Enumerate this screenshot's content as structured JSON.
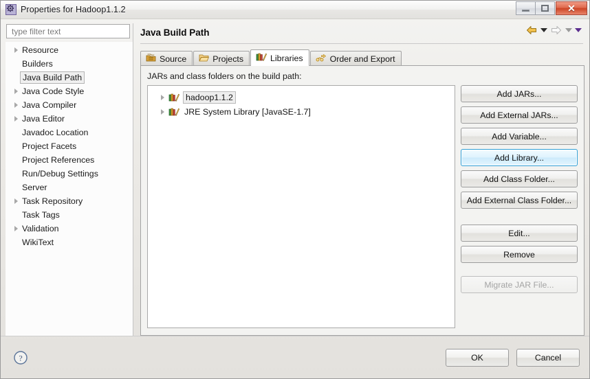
{
  "window": {
    "title": "Properties for Hadoop1.1.2",
    "icon": "gear-icon",
    "buttons": {
      "minimize": "minimize-icon",
      "maximize": "maximize-icon",
      "close": "✕"
    }
  },
  "sidebar": {
    "filter": {
      "value": "",
      "placeholder": "type filter text"
    },
    "items": [
      {
        "label": "Resource",
        "expandable": true,
        "selected": false
      },
      {
        "label": "Builders",
        "expandable": false,
        "selected": false
      },
      {
        "label": "Java Build Path",
        "expandable": false,
        "selected": true
      },
      {
        "label": "Java Code Style",
        "expandable": true,
        "selected": false
      },
      {
        "label": "Java Compiler",
        "expandable": true,
        "selected": false
      },
      {
        "label": "Java Editor",
        "expandable": true,
        "selected": false
      },
      {
        "label": "Javadoc Location",
        "expandable": false,
        "selected": false
      },
      {
        "label": "Project Facets",
        "expandable": false,
        "selected": false
      },
      {
        "label": "Project References",
        "expandable": false,
        "selected": false
      },
      {
        "label": "Run/Debug Settings",
        "expandable": false,
        "selected": false
      },
      {
        "label": "Server",
        "expandable": false,
        "selected": false
      },
      {
        "label": "Task Repository",
        "expandable": true,
        "selected": false
      },
      {
        "label": "Task Tags",
        "expandable": false,
        "selected": false
      },
      {
        "label": "Validation",
        "expandable": true,
        "selected": false
      },
      {
        "label": "WikiText",
        "expandable": false,
        "selected": false
      }
    ]
  },
  "page": {
    "title": "Java Build Path",
    "nav": {
      "back_icon": "back-arrow-icon",
      "back_menu_icon": "chevron-down-icon",
      "forward_icon": "forward-arrow-icon",
      "forward_menu_icon": "chevron-down-icon",
      "view_menu_icon": "chevron-down-icon"
    },
    "tabs": [
      {
        "label": "Source",
        "icon": "source-package-icon",
        "active": false
      },
      {
        "label": "Projects",
        "icon": "folder-icon",
        "active": false
      },
      {
        "label": "Libraries",
        "icon": "library-books-icon",
        "active": true
      },
      {
        "label": "Order and Export",
        "icon": "order-export-icon",
        "active": false
      }
    ],
    "libraries": {
      "description": "JARs and class folders on the build path:",
      "entries": [
        {
          "label": "hadoop1.1.2",
          "icon": "library-books-icon",
          "expandable": true,
          "selected": true
        },
        {
          "label": "JRE System Library [JavaSE-1.7]",
          "icon": "library-books-icon",
          "expandable": true,
          "selected": false
        }
      ],
      "buttons": [
        {
          "label": "Add JARs...",
          "state": "normal"
        },
        {
          "label": "Add External JARs...",
          "state": "normal"
        },
        {
          "label": "Add Variable...",
          "state": "normal"
        },
        {
          "label": "Add Library...",
          "state": "focused"
        },
        {
          "label": "Add Class Folder...",
          "state": "normal"
        },
        {
          "label": "Add External Class Folder...",
          "state": "normal"
        },
        {
          "label": "Edit...",
          "state": "normal"
        },
        {
          "label": "Remove",
          "state": "normal"
        },
        {
          "label": "Migrate JAR File...",
          "state": "disabled"
        }
      ]
    }
  },
  "footer": {
    "help_icon": "help-question-icon",
    "ok_label": "OK",
    "cancel_label": "Cancel"
  },
  "colors": {
    "focus_blue": "#2f9fd6",
    "close_red": "#cc4526",
    "nav_orange": "#e8a317",
    "title_icon_purple": "#5b3a8e"
  }
}
